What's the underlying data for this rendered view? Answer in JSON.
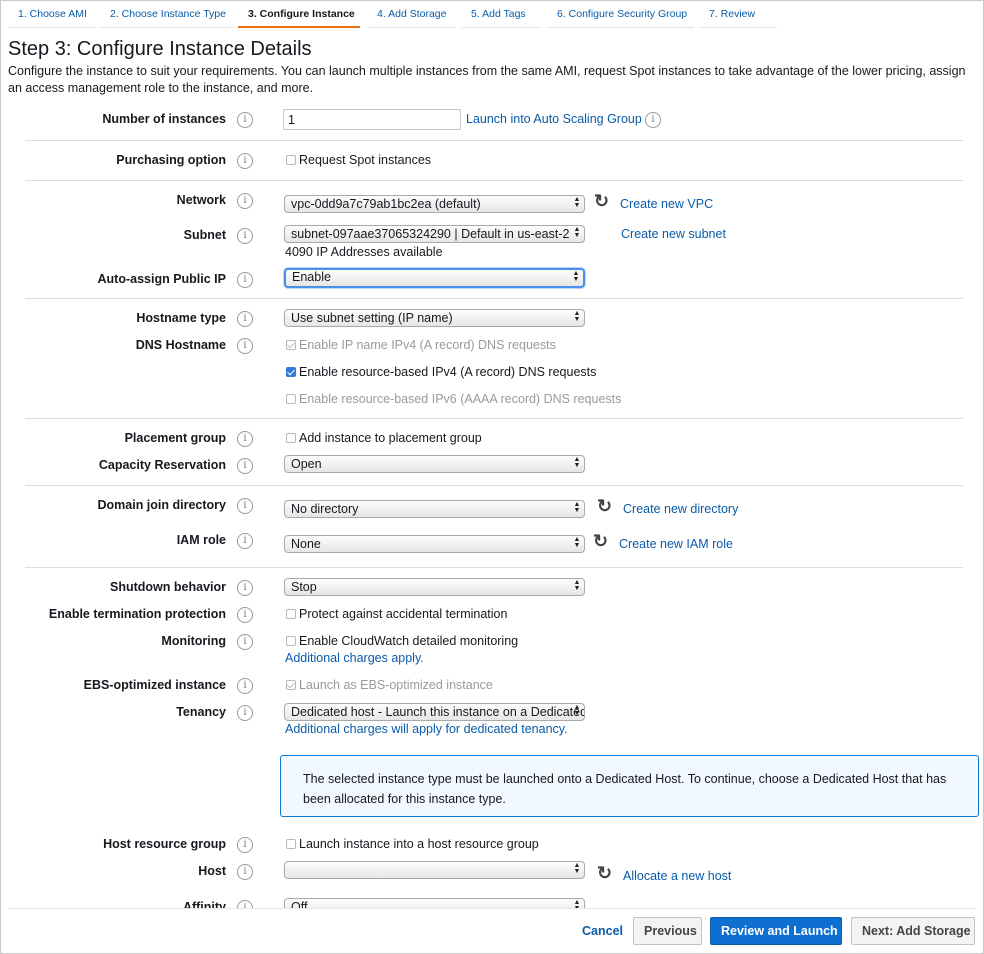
{
  "wizard": {
    "tabs": [
      {
        "label": "1. Choose AMI"
      },
      {
        "label": "2. Choose Instance Type"
      },
      {
        "label": "3. Configure Instance"
      },
      {
        "label": "4. Add Storage"
      },
      {
        "label": "5. Add Tags"
      },
      {
        "label": "6. Configure Security Group"
      },
      {
        "label": "7. Review"
      }
    ],
    "active_tab": "3. Configure Instance",
    "accent_color": "#ec7211"
  },
  "page": {
    "title": "Step 3: Configure Instance Details",
    "description": "Configure the instance to suit your requirements. You can launch multiple instances from the same AMI, request Spot instances to take advantage of the lower pricing, assign an access management role to the instance, and more."
  },
  "info_icon": "i",
  "refresh_icon": "↻",
  "form": {
    "instances": {
      "label": "Number of instances",
      "value": "1",
      "link": "Launch into Auto Scaling Group"
    },
    "purchasing": {
      "label": "Purchasing option",
      "checkbox": "Request Spot instances"
    },
    "network": {
      "label": "Network",
      "value": "vpc-0dd9a7c79ab1bc2ea (default)",
      "link": "Create new VPC"
    },
    "subnet": {
      "label": "Subnet",
      "value": "subnet-097aae37065324290 | Default in us-east-2",
      "note": "4090 IP Addresses available",
      "link": "Create new subnet"
    },
    "public_ip": {
      "label": "Auto-assign Public IP",
      "value": "Enable"
    },
    "hostname_type": {
      "label": "Hostname type",
      "value": "Use subnet setting (IP name)"
    },
    "dns_hostname": {
      "label": "DNS Hostname",
      "options": [
        "Enable IP name IPv4 (A record) DNS requests",
        "Enable resource-based IPv4 (A record) DNS requests",
        "Enable resource-based IPv6 (AAAA record) DNS requests"
      ]
    },
    "placement": {
      "label": "Placement group",
      "checkbox": "Add instance to placement group"
    },
    "capacity": {
      "label": "Capacity Reservation",
      "value": "Open"
    },
    "domain": {
      "label": "Domain join directory",
      "value": "No directory",
      "link": "Create new directory"
    },
    "iam": {
      "label": "IAM role",
      "value": "None",
      "link": "Create new IAM role"
    },
    "shutdown": {
      "label": "Shutdown behavior",
      "value": "Stop"
    },
    "termination": {
      "label": "Enable termination protection",
      "checkbox": "Protect against accidental termination"
    },
    "monitoring": {
      "label": "Monitoring",
      "checkbox": "Enable CloudWatch detailed monitoring",
      "link": "Additional charges apply."
    },
    "ebs": {
      "label": "EBS-optimized instance",
      "checkbox": "Launch as EBS-optimized instance"
    },
    "tenancy": {
      "label": "Tenancy",
      "value": "Dedicated host - Launch this instance on a Dedicated host",
      "link": "Additional charges will apply for dedicated tenancy."
    },
    "tenancy_alert": "The selected instance type must be launched onto a Dedicated Host. To continue, choose a Dedicated Host that has been allocated for this instance type.",
    "host_group": {
      "label": "Host resource group",
      "checkbox": "Launch instance into a host resource group"
    },
    "host": {
      "label": "Host",
      "value": "",
      "link": "Allocate a new host"
    },
    "affinity": {
      "label": "Affinity",
      "value": "Off"
    }
  },
  "footer": {
    "cancel": "Cancel",
    "previous": "Previous",
    "review": "Review and Launch",
    "next": "Next: Add Storage"
  }
}
